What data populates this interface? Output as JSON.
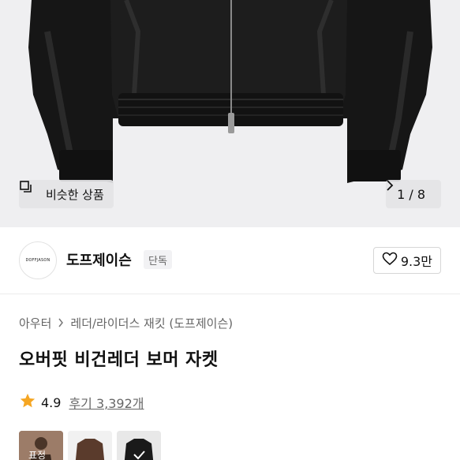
{
  "gallery": {
    "similar_label": "비슷한 상품",
    "counter": "1 / 8"
  },
  "brand": {
    "logo_text": "DOFFJASON",
    "name": "도프제이슨",
    "badge": "단독",
    "likes": "9.3만"
  },
  "breadcrumb": {
    "category": "아우터",
    "subcategory": "레더/라이더스 재킷 (도프제이슨)"
  },
  "product": {
    "title": "오버핏 비건레더 보머 자켓"
  },
  "rating": {
    "score": "4.9",
    "reviews": "후기 3,392개"
  },
  "thumbnails": {
    "first_tag": "표정"
  },
  "colors": {
    "star": "#f5a623",
    "jacket": "#141414"
  }
}
